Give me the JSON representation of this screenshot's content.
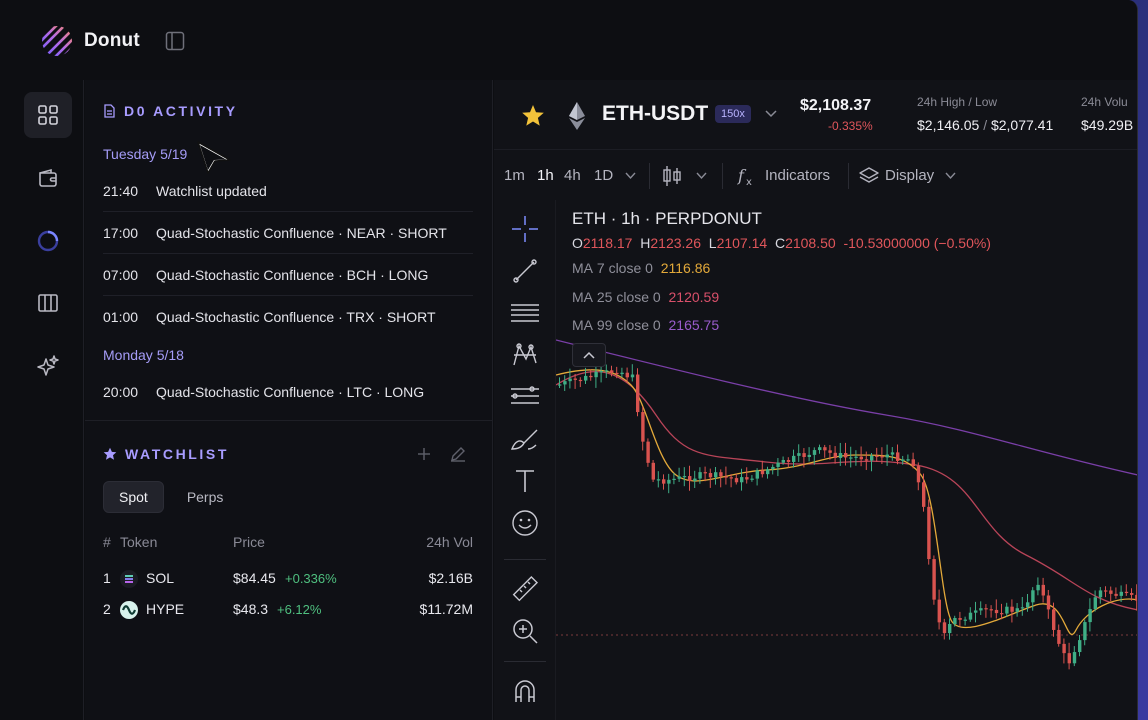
{
  "app": {
    "name": "Donut"
  },
  "activity": {
    "title": "D0 ACTIVITY",
    "days": [
      {
        "label": "Tuesday 5/19",
        "items": [
          {
            "time": "21:40",
            "text": "Watchlist updated"
          },
          {
            "time": "17:00",
            "text": "Quad-Stochastic Confluence · NEAR · SHORT"
          },
          {
            "time": "07:00",
            "text": "Quad-Stochastic Confluence · BCH · LONG"
          },
          {
            "time": "01:00",
            "text": "Quad-Stochastic Confluence · TRX · SHORT"
          }
        ]
      },
      {
        "label": "Monday 5/18",
        "items": [
          {
            "time": "20:00",
            "text": "Quad-Stochastic Confluence · LTC · LONG"
          }
        ]
      }
    ]
  },
  "watchlist": {
    "title": "WATCHLIST",
    "tabs": [
      "Spot",
      "Perps"
    ],
    "active_tab": "Spot",
    "columns": {
      "num": "#",
      "token": "Token",
      "price": "Price",
      "vol": "24h Vol"
    },
    "rows": [
      {
        "num": "1",
        "token": "SOL",
        "price": "$84.45",
        "change": "+0.336%",
        "vol": "$2.16B"
      },
      {
        "num": "2",
        "token": "HYPE",
        "price": "$48.3",
        "change": "+6.12%",
        "vol": "$11.72M"
      }
    ]
  },
  "ticker": {
    "pair": "ETH-USDT",
    "leverage": "150x",
    "price": "$2,108.37",
    "change": "-0.335%",
    "high_low_label": "24h High / Low",
    "high": "$2,146.05",
    "sep": "/",
    "low": "$2,077.41",
    "vol_label": "24h Volu",
    "vol": "$49.29B"
  },
  "toolbar": {
    "intervals": [
      "1m",
      "1h",
      "4h",
      "1D"
    ],
    "active_interval": "1h",
    "indicators": "Indicators",
    "display": "Display"
  },
  "legend": {
    "title": "ETH · 1h · PERPDONUT",
    "o_label": "O",
    "o": "2118.17",
    "h_label": "H",
    "h": "2123.26",
    "l_label": "L",
    "l": "2107.14",
    "c_label": "C",
    "c": "2108.50",
    "chg": "-10.53000000 (−0.50%)",
    "ma": [
      {
        "label": "MA",
        "params": "7 close 0",
        "value": "2116.86",
        "color": "#e3a93a"
      },
      {
        "label": "MA",
        "params": "25 close 0",
        "value": "2120.59",
        "color": "#d9506a"
      },
      {
        "label": "MA",
        "params": "99 close 0",
        "value": "2165.75",
        "color": "#8e4bc0"
      }
    ]
  },
  "colors": {
    "up": "#3fae86",
    "down": "#d9534f",
    "accent": "#a89cff"
  }
}
